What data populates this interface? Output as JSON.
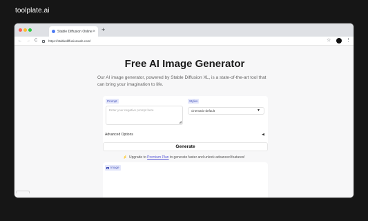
{
  "brand": "toolplate.ai",
  "browser": {
    "tab_title": "Stable Diffusion Online",
    "tab_close": "×",
    "new_tab": "+",
    "url": "https://stablediffusionweb.com/",
    "back": "←",
    "forward": "→",
    "reload": "C",
    "bookmark": "☆",
    "menu": "⋮"
  },
  "page": {
    "title": "Free AI Image Generator",
    "description": "Our AI image generator, powered by Stable Diffusion XL, is a state-of-the-art tool that can bring your imagination to life.",
    "prompt_label": "Prompt",
    "prompt_placeholder": "Enter your negative prompt here",
    "styles_label": "Styles",
    "styles_value": "cinematic-default",
    "advanced_label": "Advanced Options",
    "advanced_toggle": "◀",
    "generate_label": "Generate",
    "upgrade_prefix": "Upgrade to",
    "upgrade_link": "Premium Plan",
    "upgrade_suffix": "to generate faster and unlock advanced features!",
    "image_label": "Image"
  },
  "icons": {
    "favicon": "stable-diffusion-favicon",
    "bolt": "⚡",
    "caret": "▼"
  },
  "colors": {
    "accent": "#4452b8",
    "chip_bg": "#e4e7fb",
    "link": "#5b5bd6",
    "frame_bg": "#161616"
  }
}
